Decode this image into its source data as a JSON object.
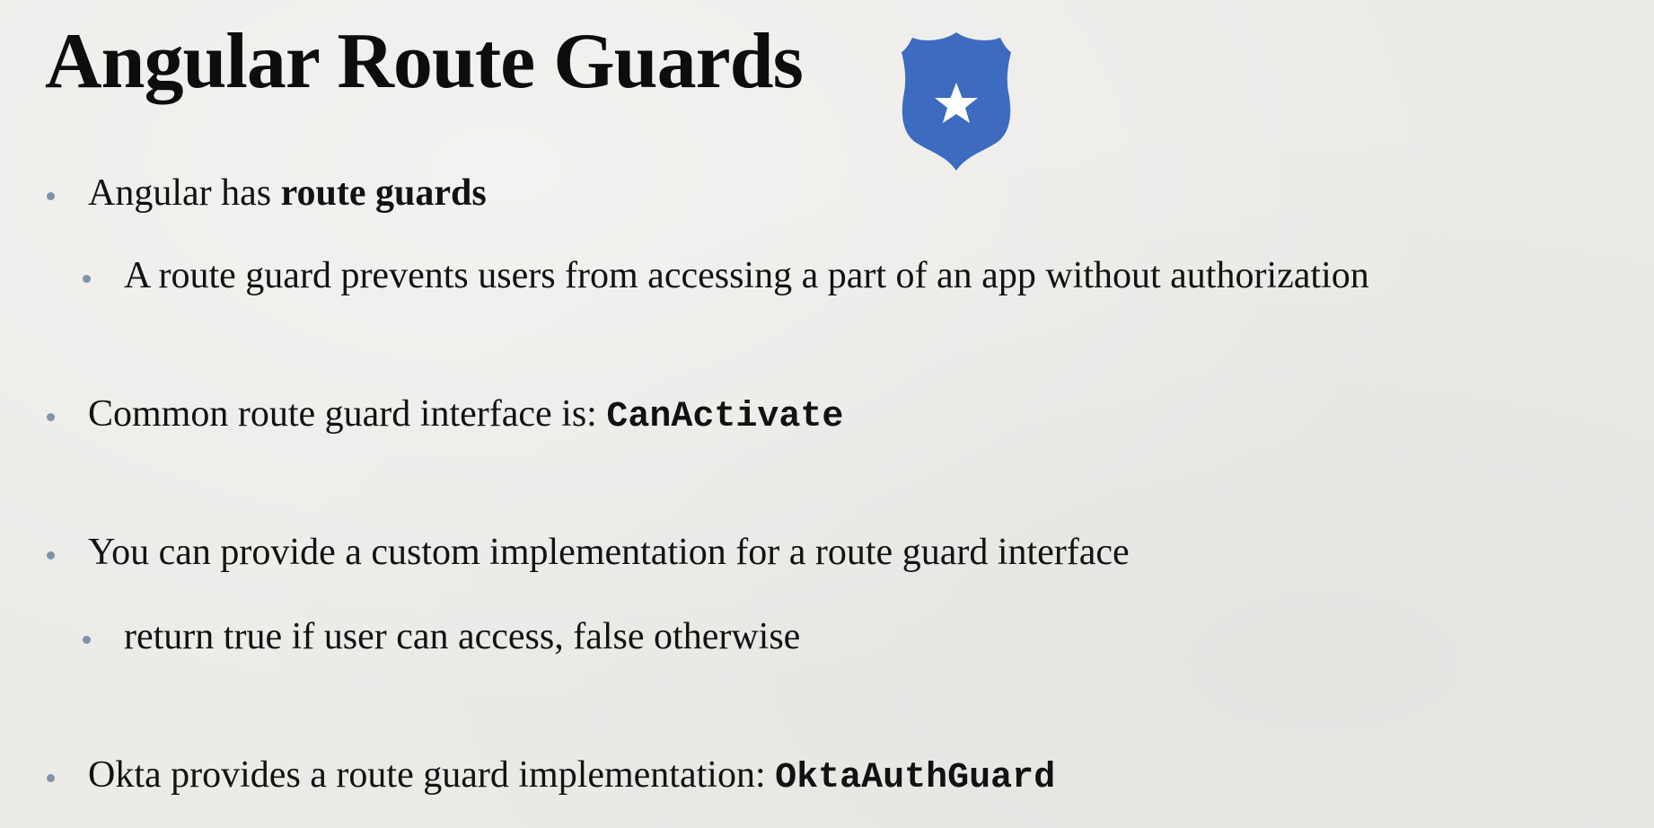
{
  "slide": {
    "title": "Angular Route Guards",
    "badge_icon": "police-badge-star-icon",
    "accent_color": "#3d6bbf",
    "bullets": [
      {
        "level": 1,
        "prefix": "Angular has ",
        "bold": "route guards"
      },
      {
        "level": 2,
        "text": "A route guard prevents users from accessing a part of an app without authorization"
      },
      {
        "level": 1,
        "prefix": "Common route guard interface is: ",
        "code": "CanActivate"
      },
      {
        "level": 1,
        "text": "You can provide a custom implementation for a route guard interface"
      },
      {
        "level": 2,
        "text": "return true if user can access, false otherwise"
      },
      {
        "level": 1,
        "prefix": "Okta provides a route guard implementation: ",
        "code": "OktaAuthGuard"
      }
    ]
  }
}
